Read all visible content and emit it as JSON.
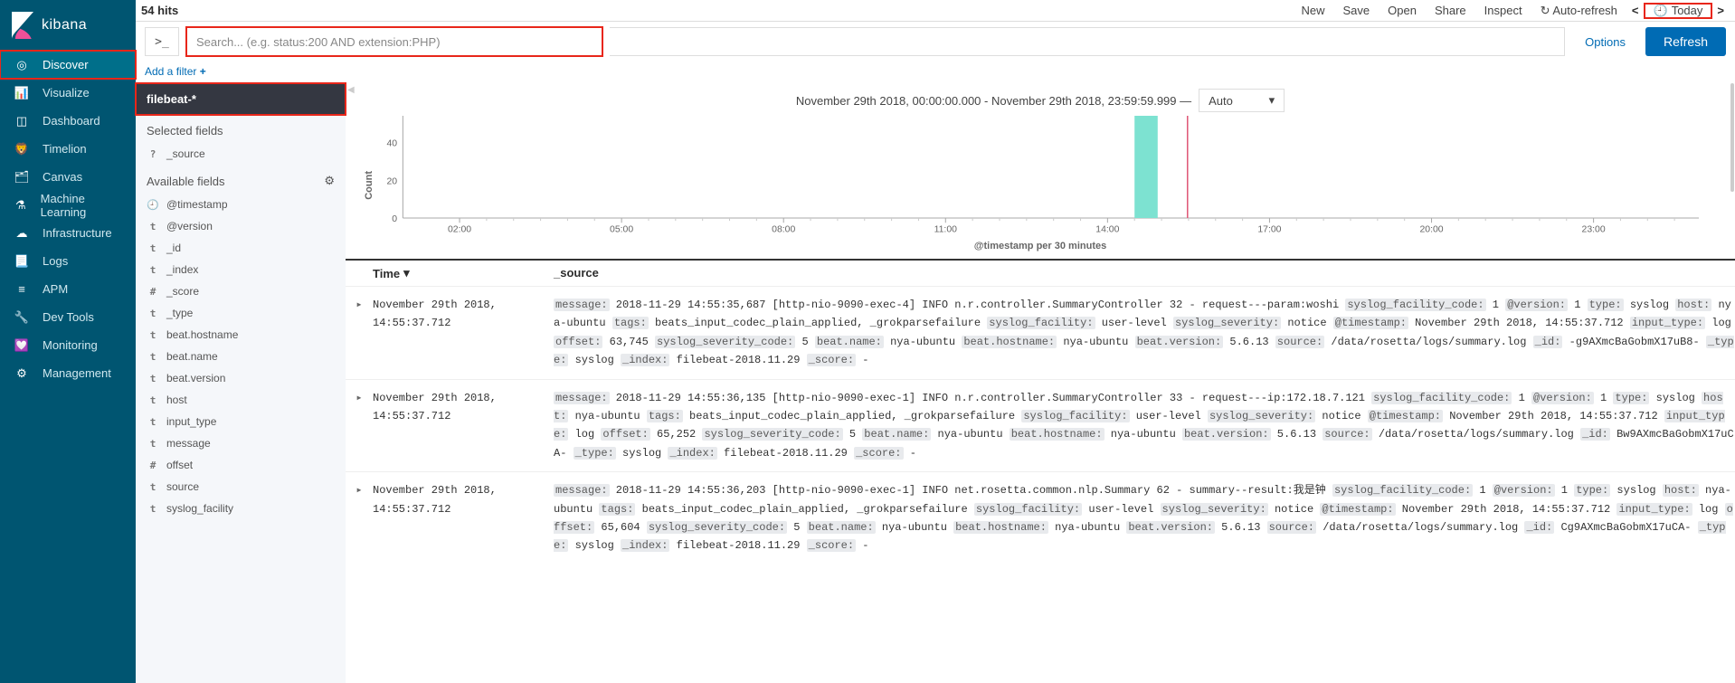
{
  "brand": "kibana",
  "sidebar": {
    "items": [
      {
        "icon": "compass-icon",
        "label": "Discover",
        "active": true
      },
      {
        "icon": "bar-chart-icon",
        "label": "Visualize"
      },
      {
        "icon": "dashboard-icon",
        "label": "Dashboard"
      },
      {
        "icon": "timelion-icon",
        "label": "Timelion"
      },
      {
        "icon": "canvas-icon",
        "label": "Canvas"
      },
      {
        "icon": "ml-icon",
        "label": "Machine Learning"
      },
      {
        "icon": "infra-icon",
        "label": "Infrastructure"
      },
      {
        "icon": "logs-icon",
        "label": "Logs"
      },
      {
        "icon": "apm-icon",
        "label": "APM"
      },
      {
        "icon": "wrench-icon",
        "label": "Dev Tools"
      },
      {
        "icon": "heart-icon",
        "label": "Monitoring"
      },
      {
        "icon": "gear-icon",
        "label": "Management"
      }
    ]
  },
  "topbar": {
    "hits": "54 hits",
    "actions": [
      "New",
      "Save",
      "Open",
      "Share",
      "Inspect"
    ],
    "autorefresh": "Auto-refresh",
    "today": "Today"
  },
  "query": {
    "placeholder": "Search... (e.g. status:200 AND extension:PHP)",
    "options": "Options",
    "refresh": "Refresh",
    "add_filter": "Add a filter"
  },
  "fields": {
    "index_pattern": "filebeat-*",
    "selected_h": "Selected fields",
    "selected": [
      {
        "type": "?",
        "name": "_source"
      }
    ],
    "available_h": "Available fields",
    "available": [
      {
        "type": "🕘",
        "name": "@timestamp"
      },
      {
        "type": "t",
        "name": "@version"
      },
      {
        "type": "t",
        "name": "_id"
      },
      {
        "type": "t",
        "name": "_index"
      },
      {
        "type": "#",
        "name": "_score"
      },
      {
        "type": "t",
        "name": "_type"
      },
      {
        "type": "t",
        "name": "beat.hostname"
      },
      {
        "type": "t",
        "name": "beat.name"
      },
      {
        "type": "t",
        "name": "beat.version"
      },
      {
        "type": "t",
        "name": "host"
      },
      {
        "type": "t",
        "name": "input_type"
      },
      {
        "type": "t",
        "name": "message"
      },
      {
        "type": "#",
        "name": "offset"
      },
      {
        "type": "t",
        "name": "source"
      },
      {
        "type": "t",
        "name": "syslog_facility"
      }
    ]
  },
  "chart_meta": {
    "time_range": "November 29th 2018, 00:00:00.000 - November 29th 2018, 23:59:59.999 —",
    "interval": "Auto",
    "xlabel": "@timestamp per 30 minutes",
    "ylabel": "Count"
  },
  "chart_data": {
    "type": "bar",
    "categories": [
      "02:00",
      "05:00",
      "08:00",
      "11:00",
      "14:00",
      "17:00",
      "20:00",
      "23:00"
    ],
    "series": [
      {
        "name": "count",
        "color": "#7de2d1",
        "bars": [
          {
            "x": "14:30",
            "value": 54
          }
        ]
      }
    ],
    "ylim": [
      0,
      54
    ],
    "yticks": [
      0,
      20,
      40
    ],
    "marker": {
      "x": "15:00",
      "color": "#e05b7a"
    },
    "xlabel": "@timestamp per 30 minutes",
    "ylabel": "Count"
  },
  "table": {
    "headers": {
      "time": "Time",
      "source": "_source"
    },
    "rows": [
      {
        "time": "November 29th 2018, 14:55:37.712",
        "src": [
          {
            "k": "message",
            "v": "2018-11-29 14:55:35,687 [http-nio-9090-exec-4] INFO n.r.controller.SummaryController 32 - request---param:woshi"
          },
          {
            "k": "syslog_facility_code",
            "v": "1"
          },
          {
            "k": "@version",
            "v": "1"
          },
          {
            "k": "type",
            "v": "syslog"
          },
          {
            "k": "host",
            "v": "nya-ubuntu"
          },
          {
            "k": "tags",
            "v": "beats_input_codec_plain_applied, _grokparsefailure"
          },
          {
            "k": "syslog_facility",
            "v": "user-level"
          },
          {
            "k": "syslog_severity",
            "v": "notice"
          },
          {
            "k": "@timestamp",
            "v": "November 29th 2018, 14:55:37.712"
          },
          {
            "k": "input_type",
            "v": "log"
          },
          {
            "k": "offset",
            "v": "63,745"
          },
          {
            "k": "syslog_severity_code",
            "v": "5"
          },
          {
            "k": "beat.name",
            "v": "nya-ubuntu"
          },
          {
            "k": "beat.hostname",
            "v": "nya-ubuntu"
          },
          {
            "k": "beat.version",
            "v": "5.6.13"
          },
          {
            "k": "source",
            "v": "/data/rosetta/logs/summary.log"
          },
          {
            "k": "_id",
            "v": "-g9AXmcBaGobmX17uB8-"
          },
          {
            "k": "_type",
            "v": "syslog"
          },
          {
            "k": "_index",
            "v": "filebeat-2018.11.29"
          },
          {
            "k": "_score",
            "v": "-"
          }
        ]
      },
      {
        "time": "November 29th 2018, 14:55:37.712",
        "src": [
          {
            "k": "message",
            "v": "2018-11-29 14:55:36,135 [http-nio-9090-exec-1] INFO n.r.controller.SummaryController 33 - request---ip:172.18.7.121"
          },
          {
            "k": "syslog_facility_code",
            "v": "1"
          },
          {
            "k": "@version",
            "v": "1"
          },
          {
            "k": "type",
            "v": "syslog"
          },
          {
            "k": "host",
            "v": "nya-ubuntu"
          },
          {
            "k": "tags",
            "v": "beats_input_codec_plain_applied, _grokparsefailure"
          },
          {
            "k": "syslog_facility",
            "v": "user-level"
          },
          {
            "k": "syslog_severity",
            "v": "notice"
          },
          {
            "k": "@timestamp",
            "v": "November 29th 2018, 14:55:37.712"
          },
          {
            "k": "input_type",
            "v": "log"
          },
          {
            "k": "offset",
            "v": "65,252"
          },
          {
            "k": "syslog_severity_code",
            "v": "5"
          },
          {
            "k": "beat.name",
            "v": "nya-ubuntu"
          },
          {
            "k": "beat.hostname",
            "v": "nya-ubuntu"
          },
          {
            "k": "beat.version",
            "v": "5.6.13"
          },
          {
            "k": "source",
            "v": "/data/rosetta/logs/summary.log"
          },
          {
            "k": "_id",
            "v": "Bw9AXmcBaGobmX17uCA-"
          },
          {
            "k": "_type",
            "v": "syslog"
          },
          {
            "k": "_index",
            "v": "filebeat-2018.11.29"
          },
          {
            "k": "_score",
            "v": "-"
          }
        ]
      },
      {
        "time": "November 29th 2018, 14:55:37.712",
        "src": [
          {
            "k": "message",
            "v": "2018-11-29 14:55:36,203 [http-nio-9090-exec-1] INFO net.rosetta.common.nlp.Summary 62 - summary--result:我是钟"
          },
          {
            "k": "syslog_facility_code",
            "v": "1"
          },
          {
            "k": "@version",
            "v": "1"
          },
          {
            "k": "type",
            "v": "syslog"
          },
          {
            "k": "host",
            "v": "nya-ubuntu"
          },
          {
            "k": "tags",
            "v": "beats_input_codec_plain_applied, _grokparsefailure"
          },
          {
            "k": "syslog_facility",
            "v": "user-level"
          },
          {
            "k": "syslog_severity",
            "v": "notice"
          },
          {
            "k": "@timestamp",
            "v": "November 29th 2018, 14:55:37.712"
          },
          {
            "k": "input_type",
            "v": "log"
          },
          {
            "k": "offset",
            "v": "65,604"
          },
          {
            "k": "syslog_severity_code",
            "v": "5"
          },
          {
            "k": "beat.name",
            "v": "nya-ubuntu"
          },
          {
            "k": "beat.hostname",
            "v": "nya-ubuntu"
          },
          {
            "k": "beat.version",
            "v": "5.6.13"
          },
          {
            "k": "source",
            "v": "/data/rosetta/logs/summary.log"
          },
          {
            "k": "_id",
            "v": "Cg9AXmcBaGobmX17uCA-"
          },
          {
            "k": "_type",
            "v": "syslog"
          },
          {
            "k": "_index",
            "v": "filebeat-2018.11.29"
          },
          {
            "k": "_score",
            "v": "-"
          }
        ]
      }
    ]
  }
}
